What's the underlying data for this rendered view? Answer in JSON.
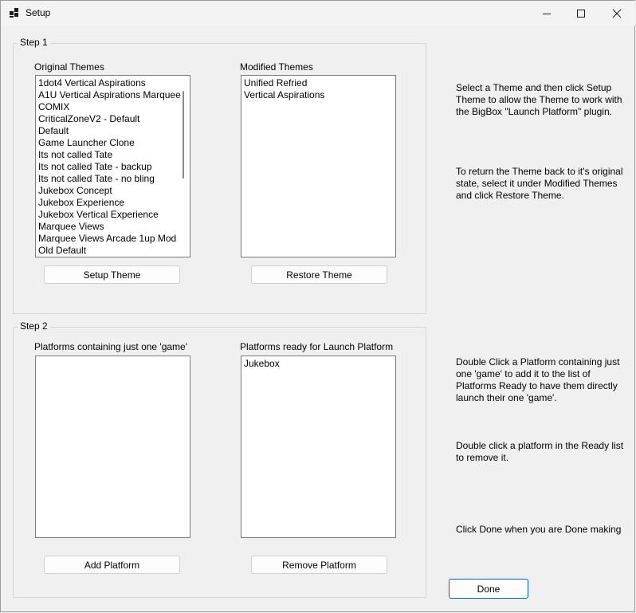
{
  "window": {
    "title": "Setup"
  },
  "step1": {
    "title": "Step 1",
    "original_label": "Original Themes",
    "modified_label": "Modified Themes",
    "original_items": [
      "1dot4 Vertical Aspirations",
      "A1U Vertical Aspirations Marquee",
      "COMIX",
      "CriticalZoneV2 - Default",
      "Default",
      "Game Launcher Clone",
      "Its not called Tate",
      "Its not called Tate - backup",
      "Its not called Tate - no bling",
      "Jukebox Concept",
      "Jukebox Experience",
      "Jukebox Vertical Experience",
      "Marquee Views",
      "Marquee Views Arcade 1up Mod",
      "Old Default"
    ],
    "modified_items": [
      "Unified Refried",
      "Vertical Aspirations"
    ],
    "setup_button": "Setup Theme",
    "restore_button": "Restore Theme"
  },
  "step2": {
    "title": "Step 2",
    "single_label": "Platforms containing just one 'game'",
    "ready_label": "Platforms ready for Launch Platform",
    "single_items": [],
    "ready_items": [
      "Jukebox"
    ],
    "add_button": "Add Platform",
    "remove_button": "Remove Platform"
  },
  "help": {
    "p1": "Select a Theme and then click Setup Theme to allow the Theme to work with the BigBox \"Launch Platform\" plugin.",
    "p2": "To return the Theme back to it's original state, select it under Modified Themes and click Restore Theme.",
    "p3": "Double Click a Platform containing just one 'game' to add it to the list of Platforms Ready to have them directly launch their one 'game'.",
    "p4": "Double click a platform in the Ready list to remove it.",
    "p5": "Click Done when you are Done making"
  },
  "done_button": "Done"
}
